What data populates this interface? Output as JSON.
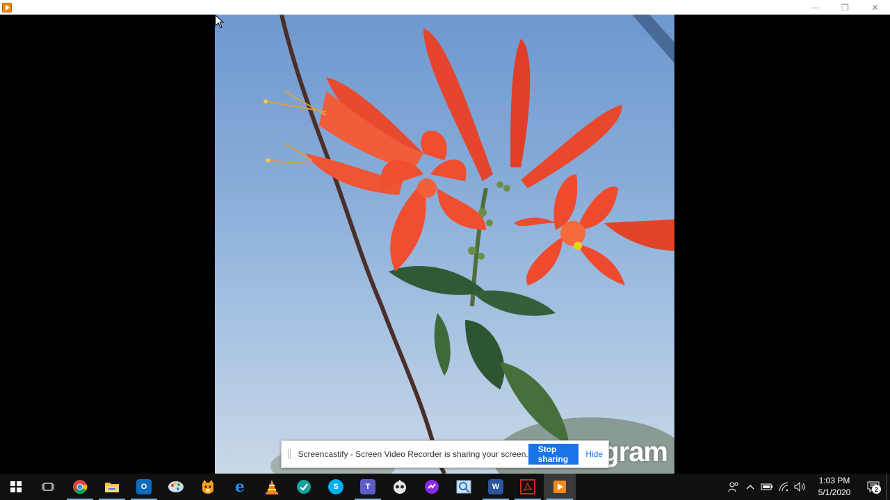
{
  "window": {
    "controls": {
      "minimize": "—",
      "restore": "❐",
      "close": "✕"
    }
  },
  "video": {
    "watermark": "gram"
  },
  "share_bar": {
    "message": "Screencastify - Screen Video Recorder is sharing your screen.",
    "stop_label": "Stop sharing",
    "hide_label": "Hide"
  },
  "taskbar": {
    "apps": [
      {
        "name": "start",
        "icon": "windows-icon"
      },
      {
        "name": "task-view",
        "icon": "task-view-icon"
      },
      {
        "name": "chrome",
        "icon": "chrome-icon",
        "color": "#db4437"
      },
      {
        "name": "file-explorer",
        "icon": "folder-icon",
        "color": "#f2c14e"
      },
      {
        "name": "outlook",
        "icon": "outlook-icon",
        "color": "#0f6cbd",
        "glyph": "O"
      },
      {
        "name": "paint",
        "icon": "paint-icon",
        "color": "#8aa0b5"
      },
      {
        "name": "scratch",
        "icon": "cat-icon",
        "color": "#ff9f1a"
      },
      {
        "name": "internet-explorer",
        "icon": "ie-icon",
        "color": "#1e90ff",
        "glyph": "e"
      },
      {
        "name": "vlc",
        "icon": "vlc-cone-icon",
        "color": "#ff8800"
      },
      {
        "name": "app-teal",
        "icon": "teal-check-icon",
        "color": "#16a29a"
      },
      {
        "name": "skype",
        "icon": "skype-icon",
        "color": "#00aff0",
        "glyph": "S"
      },
      {
        "name": "teams",
        "icon": "teams-icon",
        "color": "#5b5fc7",
        "glyph": "T"
      },
      {
        "name": "app-robot",
        "icon": "robot-icon",
        "color": "#d0d0d0"
      },
      {
        "name": "onenote-class",
        "icon": "purple-app-icon",
        "color": "#8a2be2"
      },
      {
        "name": "image-viewer",
        "icon": "image-viewer-icon",
        "color": "#7fb3e0"
      },
      {
        "name": "word",
        "icon": "word-icon",
        "color": "#2b579a",
        "glyph": "W"
      },
      {
        "name": "acrobat",
        "icon": "acrobat-icon",
        "color": "#d7261e"
      },
      {
        "name": "media-player",
        "icon": "media-player-icon",
        "color": "#f08a1c"
      }
    ],
    "tray": {
      "time": "1:03 PM",
      "date": "5/1/2020",
      "notification_count": "2"
    }
  }
}
